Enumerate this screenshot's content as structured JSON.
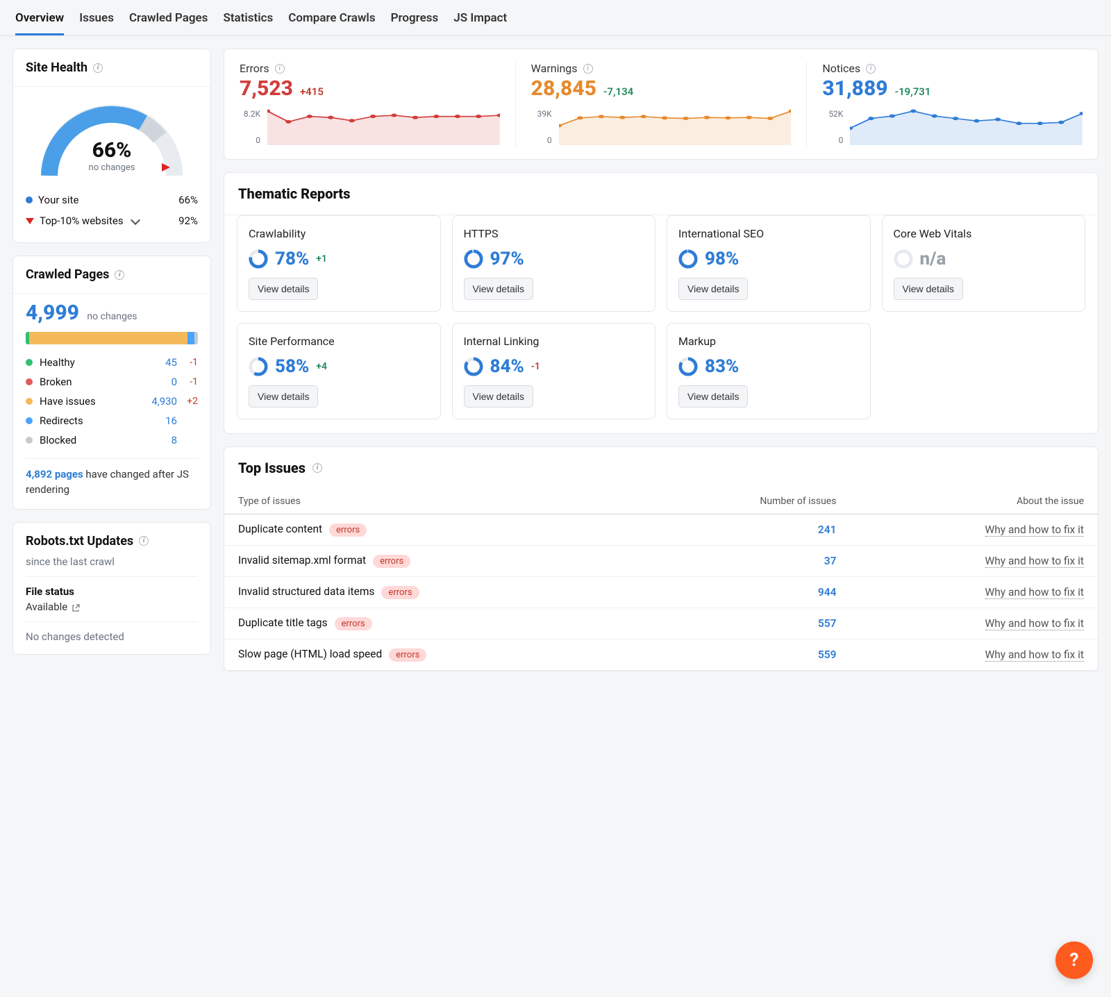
{
  "tabs": [
    "Overview",
    "Issues",
    "Crawled Pages",
    "Statistics",
    "Compare Crawls",
    "Progress",
    "JS Impact"
  ],
  "active_tab_index": 0,
  "site_health": {
    "title": "Site Health",
    "percent_label": "66%",
    "sub": "no changes",
    "legend": {
      "your_site_label": "Your site",
      "your_site_pct": "66%",
      "top10_label": "Top-10% websites",
      "top10_pct": "92%"
    }
  },
  "crawled_pages": {
    "title": "Crawled Pages",
    "total": "4,999",
    "total_sub": "no changes",
    "bar_segments": [
      {
        "color": "#2fbf71",
        "w": 2
      },
      {
        "color": "#f5b95a",
        "w": 92
      },
      {
        "color": "#4aa3ff",
        "w": 4
      },
      {
        "color": "#c5cad1",
        "w": 2
      }
    ],
    "rows": [
      {
        "dot": "#2fbf71",
        "label": "Healthy",
        "value": "45",
        "delta": "-1",
        "delta_class": "neg"
      },
      {
        "dot": "#e05b5b",
        "label": "Broken",
        "value": "0",
        "delta": "-1",
        "delta_class": "neg"
      },
      {
        "dot": "#f5b95a",
        "label": "Have issues",
        "value": "4,930",
        "delta": "+2",
        "delta_class": "pos"
      },
      {
        "dot": "#4aa3ff",
        "label": "Redirects",
        "value": "16",
        "delta": "",
        "delta_class": ""
      },
      {
        "dot": "#c5cad1",
        "label": "Blocked",
        "value": "8",
        "delta": "",
        "delta_class": ""
      }
    ],
    "after_js_link": "4,892 pages",
    "after_js_rest": " have changed after JS rendering"
  },
  "robots": {
    "title": "Robots.txt Updates",
    "sub": "since the last crawl",
    "file_status_label": "File status",
    "file_status_value": "Available",
    "footer": "No changes detected"
  },
  "metrics3": {
    "errors": {
      "label": "Errors",
      "value": "7,523",
      "delta": "+415",
      "delta_color": "#c0392b",
      "color": "#d23c3c",
      "ytop": "8.2K",
      "series": [
        60,
        40,
        50,
        48,
        42,
        50,
        52,
        48,
        50,
        50,
        50,
        52
      ]
    },
    "warnings": {
      "label": "Warnings",
      "value": "28,845",
      "delta": "-7,134",
      "delta_color": "#1f8a5b",
      "color": "#e68a2e",
      "ytop": "39K",
      "series": [
        38,
        55,
        58,
        56,
        58,
        55,
        54,
        56,
        55,
        56,
        54,
        70
      ]
    },
    "notices": {
      "label": "Notices",
      "value": "31,889",
      "delta": "-19,731",
      "delta_color": "#1f8a5b",
      "color": "#2e7cd6",
      "ytop": "52K",
      "series": [
        30,
        50,
        55,
        65,
        55,
        50,
        45,
        48,
        40,
        40,
        42,
        60
      ]
    }
  },
  "thematic": {
    "title": "Thematic Reports",
    "btn_label": "View details",
    "cards": [
      {
        "name": "Crawlability",
        "pct": "78%",
        "pct_val": 78,
        "delta": "+1",
        "delta_color": "#1f8a5b"
      },
      {
        "name": "HTTPS",
        "pct": "97%",
        "pct_val": 97,
        "delta": "",
        "delta_color": ""
      },
      {
        "name": "International SEO",
        "pct": "98%",
        "pct_val": 98,
        "delta": "",
        "delta_color": ""
      },
      {
        "name": "Core Web Vitals",
        "pct": "n/a",
        "pct_val": 0,
        "delta": "",
        "delta_color": "",
        "na": true
      },
      {
        "name": "Site Performance",
        "pct": "58%",
        "pct_val": 58,
        "delta": "+4",
        "delta_color": "#1f8a5b"
      },
      {
        "name": "Internal Linking",
        "pct": "84%",
        "pct_val": 84,
        "delta": "-1",
        "delta_color": "#c0392b"
      },
      {
        "name": "Markup",
        "pct": "83%",
        "pct_val": 83,
        "delta": "",
        "delta_color": ""
      }
    ]
  },
  "top_issues": {
    "title": "Top Issues",
    "columns": [
      "Type of issues",
      "Number of issues",
      "About the issue"
    ],
    "pill_label": "errors",
    "fix_label": "Why and how to fix it",
    "rows": [
      {
        "name": "Duplicate content",
        "count": "241"
      },
      {
        "name": "Invalid sitemap.xml format",
        "count": "37"
      },
      {
        "name": "Invalid structured data items",
        "count": "944"
      },
      {
        "name": "Duplicate title tags",
        "count": "557"
      },
      {
        "name": "Slow page (HTML) load speed",
        "count": "559"
      }
    ]
  },
  "chart_data": [
    {
      "type": "line",
      "series_name": "Errors",
      "y": [
        7000,
        5500,
        6200,
        6100,
        5800,
        6200,
        6300,
        6100,
        6200,
        6200,
        6200,
        6300
      ],
      "ylim": [
        0,
        8200
      ],
      "ylabel": "",
      "title": "Errors trend"
    },
    {
      "type": "line",
      "series_name": "Warnings",
      "y": [
        24000,
        34000,
        35500,
        34500,
        35500,
        34000,
        33500,
        34500,
        34000,
        34500,
        33500,
        36500
      ],
      "ylim": [
        0,
        39000
      ],
      "ylabel": "",
      "title": "Warnings trend"
    },
    {
      "type": "line",
      "series_name": "Notices",
      "y": [
        36000,
        46000,
        48000,
        51000,
        48000,
        46000,
        44000,
        45000,
        41000,
        41000,
        42000,
        50000
      ],
      "ylim": [
        0,
        52000
      ],
      "ylabel": "",
      "title": "Notices trend"
    }
  ],
  "help_fab": "?"
}
